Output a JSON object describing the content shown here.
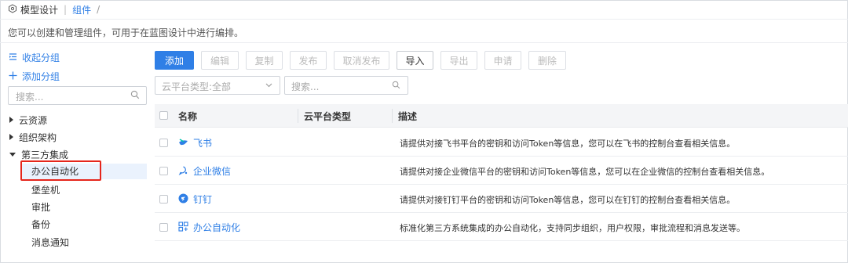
{
  "breadcrumb": {
    "home": "模型设计",
    "current": "组件",
    "slash": "/"
  },
  "description": "您可以创建和管理组件，可用于在蓝图设计中进行编排。",
  "sidebar": {
    "collapse_label": "收起分组",
    "add_label": "添加分组",
    "search_placeholder": "搜索...",
    "tree": [
      {
        "label": "云资源",
        "expanded": false
      },
      {
        "label": "组织架构",
        "expanded": false
      },
      {
        "label": "第三方集成",
        "expanded": true
      }
    ],
    "children": [
      "办公自动化",
      "堡垒机",
      "审批",
      "备份",
      "消息通知"
    ],
    "selected": "办公自动化"
  },
  "toolbar": {
    "add": "添加",
    "edit": "编辑",
    "copy": "复制",
    "publish": "发布",
    "unpublish": "取消发布",
    "import": "导入",
    "export": "导出",
    "apply": "申请",
    "delete": "删除"
  },
  "filters": {
    "cloud_type_placeholder": "云平台类型:全部",
    "search_placeholder": "搜索..."
  },
  "table": {
    "headers": {
      "name": "名称",
      "cloud_type": "云平台类型",
      "desc": "描述"
    },
    "rows": [
      {
        "name": "飞书",
        "icon": "feishu-icon",
        "cloud_type": "",
        "desc": "请提供对接飞书平台的密钥和访问Token等信息，您可以在飞书的控制台查看相关信息。"
      },
      {
        "name": "企业微信",
        "icon": "wecom-icon",
        "cloud_type": "",
        "desc": "请提供对接企业微信平台的密钥和访问Token等信息，您可以在企业微信的控制台查看相关信息。"
      },
      {
        "name": "钉钉",
        "icon": "dingtalk-icon",
        "cloud_type": "",
        "desc": "请提供对接钉钉平台的密钥和访问Token等信息，您可以在钉钉的控制台查看相关信息。"
      },
      {
        "name": "办公自动化",
        "icon": "office-automation-icon",
        "cloud_type": "",
        "desc": "标准化第三方系统集成的办公自动化，支持同步组织，用户权限，审批流程和消息发送等。"
      }
    ]
  },
  "colors": {
    "accent": "#2f7fe6",
    "highlight_box": "#e5261c"
  }
}
